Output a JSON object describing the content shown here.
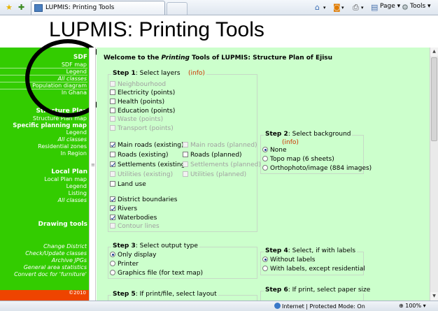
{
  "browser": {
    "tab_title": "LUPMIS: Printing Tools",
    "commands": {
      "page": "Page",
      "tools": "Tools"
    },
    "icons": {
      "favorites": "star-icon",
      "add_favorites": "add-favorite-icon",
      "home": "home-icon",
      "feeds": "rss-icon",
      "print": "print-icon",
      "page": "page-icon",
      "tools": "gear-icon"
    }
  },
  "header": {
    "title": "LUPMIS: Printing Tools"
  },
  "sidebar": {
    "sdf": {
      "heading": "SDF",
      "items": [
        "SDF map",
        "Legend",
        "All classes",
        "Population diagram",
        "In Ghana"
      ]
    },
    "structure_plan": {
      "heading": "Structure Plan",
      "items": [
        "Structure Plan map",
        "Specific planning map",
        "Legend",
        "All classes",
        "Residential zones",
        "In Region"
      ]
    },
    "local_plan": {
      "heading": "Local Plan",
      "items": [
        "Local Plan map",
        "Legend",
        "Listing",
        "All classes"
      ]
    },
    "drawing_tools": {
      "heading": "Drawing tools"
    },
    "tools": {
      "items": [
        "Change District",
        "Check/Update classes",
        "Archive JPGs",
        "General area statistics",
        "Convert doc for 'furniture'"
      ]
    },
    "footer": "©2010"
  },
  "content": {
    "welcome_pre": "Welcome to the ",
    "welcome_em": "Printing",
    "welcome_post": " Tools of LUPMIS: Structure Plan of Ejisu",
    "info_label": "(info)",
    "step1": {
      "label": "Step 1",
      "text": ": Select layers",
      "layers": {
        "neighbourhood": "Neighbourhood",
        "electricity": "Electricity (points)",
        "health": "Health (points)",
        "education": "Education (points)",
        "waste": "Waste (points)",
        "transport": "Transport (points)",
        "main_roads_existing": "Main roads (existing)",
        "main_roads_planned": "Main roads (planned)",
        "roads_existing": "Roads (existing)",
        "roads_planned": "Roads (planned)",
        "settlements_existing": "Settlements (existing)",
        "settlements_planned": "Settlements (planned)",
        "utilities_existing": "Utilities (existing)",
        "utilities_planned": "Utilities (planned)",
        "land_use": "Land use",
        "district_boundaries": "District boundaries",
        "rivers": "Rivers",
        "waterbodies": "Waterbodies",
        "contour_lines": "Contour lines"
      }
    },
    "step2": {
      "label": "Step 2",
      "text": ": Select background",
      "options": [
        "None",
        "Topo map (6 sheets)",
        "Orthophoto/image (884 images)"
      ]
    },
    "step3": {
      "label": "Step 3",
      "text": ": Select output type",
      "options": [
        "Only display",
        "Printer",
        "Graphics file (for text map)"
      ]
    },
    "step4": {
      "label": "Step 4",
      "text": ": Select, if with labels",
      "options": [
        "Without labels",
        "With labels, except residential"
      ]
    },
    "step5": {
      "label": "Step 5",
      "text": ": If print/file, select layout"
    },
    "step6": {
      "label": "Step 6",
      "text": ": If print, select paper size"
    }
  },
  "statusbar": {
    "zone": "Internet | Protected Mode: On",
    "zoom": "100%"
  }
}
